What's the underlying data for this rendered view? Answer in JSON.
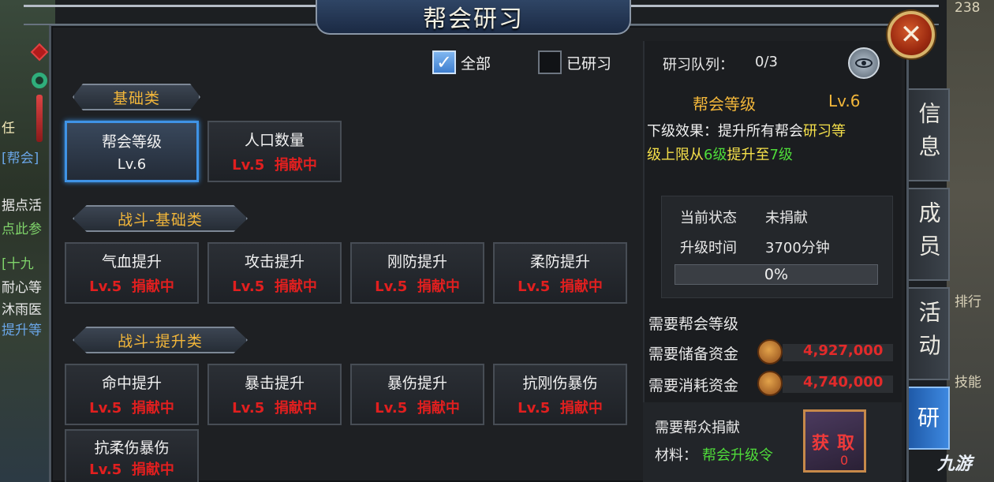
{
  "title": "帮会研习",
  "background": {
    "left_texts": [
      "任",
      "[帮会]",
      "据点活",
      "点此参",
      "[十九",
      "耐心等",
      "沐雨医",
      "提升等"
    ],
    "right_texts": [
      "238",
      "排行",
      "技能"
    ]
  },
  "filters": [
    {
      "label": "全部",
      "checked": true
    },
    {
      "label": "已研习",
      "checked": false
    }
  ],
  "sections": [
    {
      "title": "基础类",
      "items": [
        {
          "name": "帮会等级",
          "level": "Lv.6",
          "status": "",
          "selected": true
        },
        {
          "name": "人口数量",
          "level": "Lv.5",
          "status": "捐献中",
          "selected": false
        }
      ]
    },
    {
      "title": "战斗-基础类",
      "items": [
        {
          "name": "气血提升",
          "level": "Lv.5",
          "status": "捐献中"
        },
        {
          "name": "攻击提升",
          "level": "Lv.5",
          "status": "捐献中"
        },
        {
          "name": "刚防提升",
          "level": "Lv.5",
          "status": "捐献中"
        },
        {
          "name": "柔防提升",
          "level": "Lv.5",
          "status": "捐献中"
        }
      ]
    },
    {
      "title": "战斗-提升类",
      "items": [
        {
          "name": "命中提升",
          "level": "Lv.5",
          "status": "捐献中"
        },
        {
          "name": "暴击提升",
          "level": "Lv.5",
          "status": "捐献中"
        },
        {
          "name": "暴伤提升",
          "level": "Lv.5",
          "status": "捐献中"
        },
        {
          "name": "抗刚伤暴伤",
          "level": "Lv.5",
          "status": "捐献中"
        },
        {
          "name": "抗柔伤暴伤",
          "level": "Lv.5",
          "status": "捐献中"
        }
      ]
    }
  ],
  "detail": {
    "queue_label": "研习队列：",
    "queue_value": "0/3",
    "name": "帮会等级",
    "level": "Lv.6",
    "next_prefix": "下级效果：提升所有帮会",
    "next_highlight": "研习等",
    "next_line2_a": "级上限从",
    "next_line2_b": "6级",
    "next_line2_c": "提升至",
    "next_line2_d": "7级",
    "state_label": "当前状态",
    "state_value": "未捐献",
    "time_label": "升级时间",
    "time_value": "3700分钟",
    "progress_pct": 0,
    "progress_text": "0%",
    "req_level_label": "需要帮会等级",
    "req_reserve_label": "需要储备资金",
    "req_reserve_value": "4,927,000",
    "req_consume_label": "需要消耗资金",
    "req_consume_value": "4,740,000",
    "donate_label": "需要帮众捐献",
    "material_label": "材料：",
    "material_value": "帮会升级令",
    "slot_text": "获取",
    "slot_count": "0"
  },
  "tabs": [
    {
      "label": "信息",
      "active": false
    },
    {
      "label": "成员",
      "active": false
    },
    {
      "label": "活动",
      "active": false
    },
    {
      "label": "研",
      "active": true
    }
  ],
  "watermark": "九游",
  "colors": {
    "accent_blue": "#3f93e6",
    "section_gold": "#f2b63a",
    "status_red": "#e11f1f",
    "highlight_yellow": "#f5e04a",
    "highlight_green": "#4fdc3a"
  }
}
